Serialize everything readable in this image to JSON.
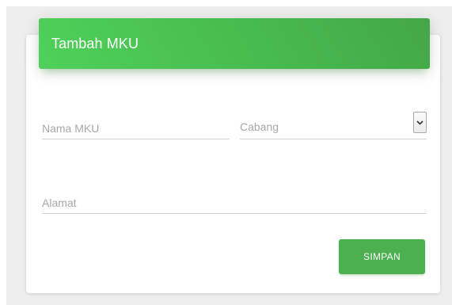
{
  "card": {
    "title": "Tambah MKU"
  },
  "form": {
    "nama_placeholder": "Nama MKU",
    "cabang_label": "Cabang",
    "alamat_placeholder": "Alamat"
  },
  "actions": {
    "save_label": "SIMPAN"
  },
  "icons": {
    "dropdown": "chevron-down-icon"
  },
  "colors": {
    "header_gradient_start": "#4fd15a",
    "header_gradient_end": "#43a846",
    "button_bg": "#4caf50",
    "underline": "#d2d2d2"
  }
}
